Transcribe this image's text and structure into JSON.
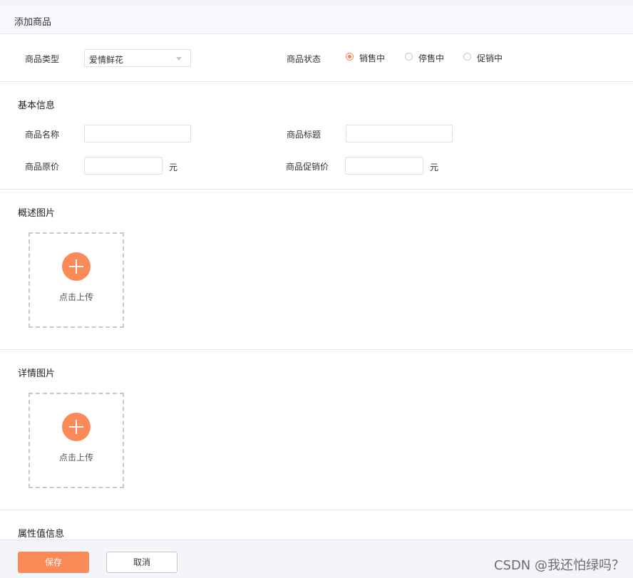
{
  "header": {
    "title": "添加商品"
  },
  "type_row": {
    "type_label": "商品类型",
    "type_value": "爱情鲜花",
    "status_label": "商品状态",
    "status_options": [
      "销售中",
      "停售中",
      "促销中"
    ],
    "status_selected": "销售中"
  },
  "basic": {
    "title": "基本信息",
    "name_label": "商品名称",
    "name_value": "",
    "subtitle_label": "商品标题",
    "subtitle_value": "",
    "price_label": "商品原价",
    "price_value": "",
    "price_unit": "元",
    "promo_label": "商品促销价",
    "promo_value": "",
    "promo_unit": "元"
  },
  "overview_images": {
    "title": "概述图片",
    "upload_label": "点击上传"
  },
  "detail_images": {
    "title": "详情图片",
    "upload_label": "点击上传"
  },
  "attributes": {
    "title": "属性值信息"
  },
  "footer": {
    "save_label": "保存",
    "cancel_label": "取消"
  },
  "watermark": "CSDN @我还怕绿吗？",
  "colors": {
    "accent": "#fa8a58",
    "border": "#dcdfe6",
    "footer_bg": "#f4f5fa"
  }
}
